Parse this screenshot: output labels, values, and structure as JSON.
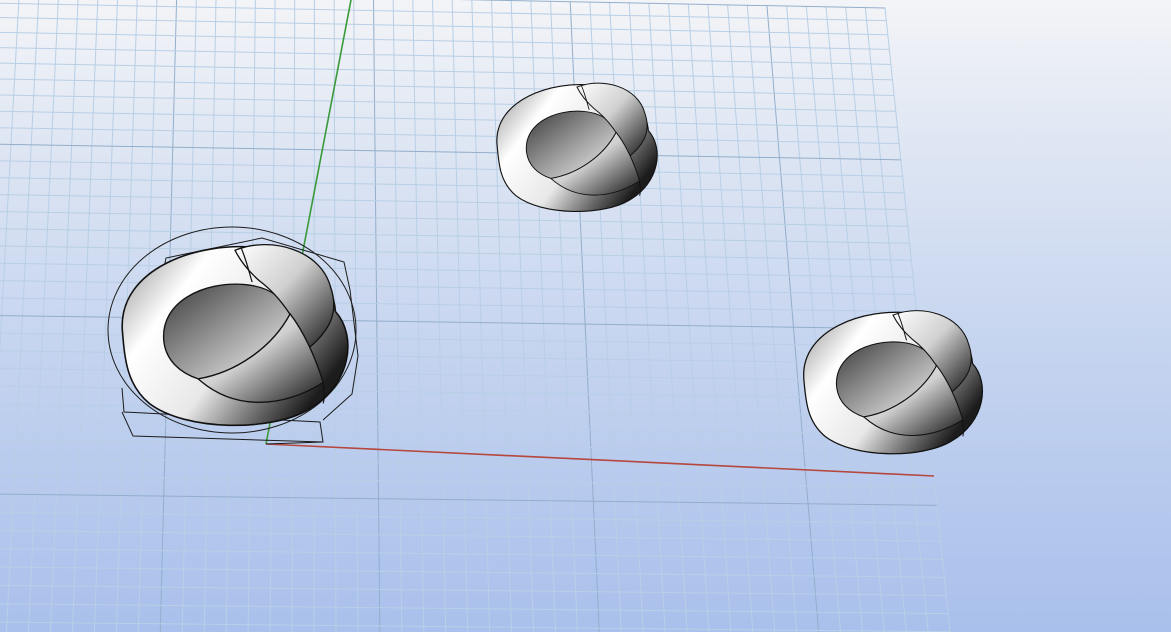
{
  "viewport": {
    "name": "perspective-3d-viewport",
    "background": [
      "#f3f4f7",
      "#dde5f3",
      "#c5d4ef",
      "#a9c0ec"
    ]
  },
  "construction_plane": {
    "grid_color_minor": "#b8cfe6",
    "grid_color_major": "#93aecb",
    "x_axis_color": "#b5473e",
    "y_axis_color": "#3a9a3a"
  },
  "objects": [
    {
      "name": "mobius-strip",
      "selected": true
    },
    {
      "name": "mobius-strip",
      "selected": false
    },
    {
      "name": "mobius-strip",
      "selected": false
    }
  ],
  "selection_color": "#1b1b1b"
}
